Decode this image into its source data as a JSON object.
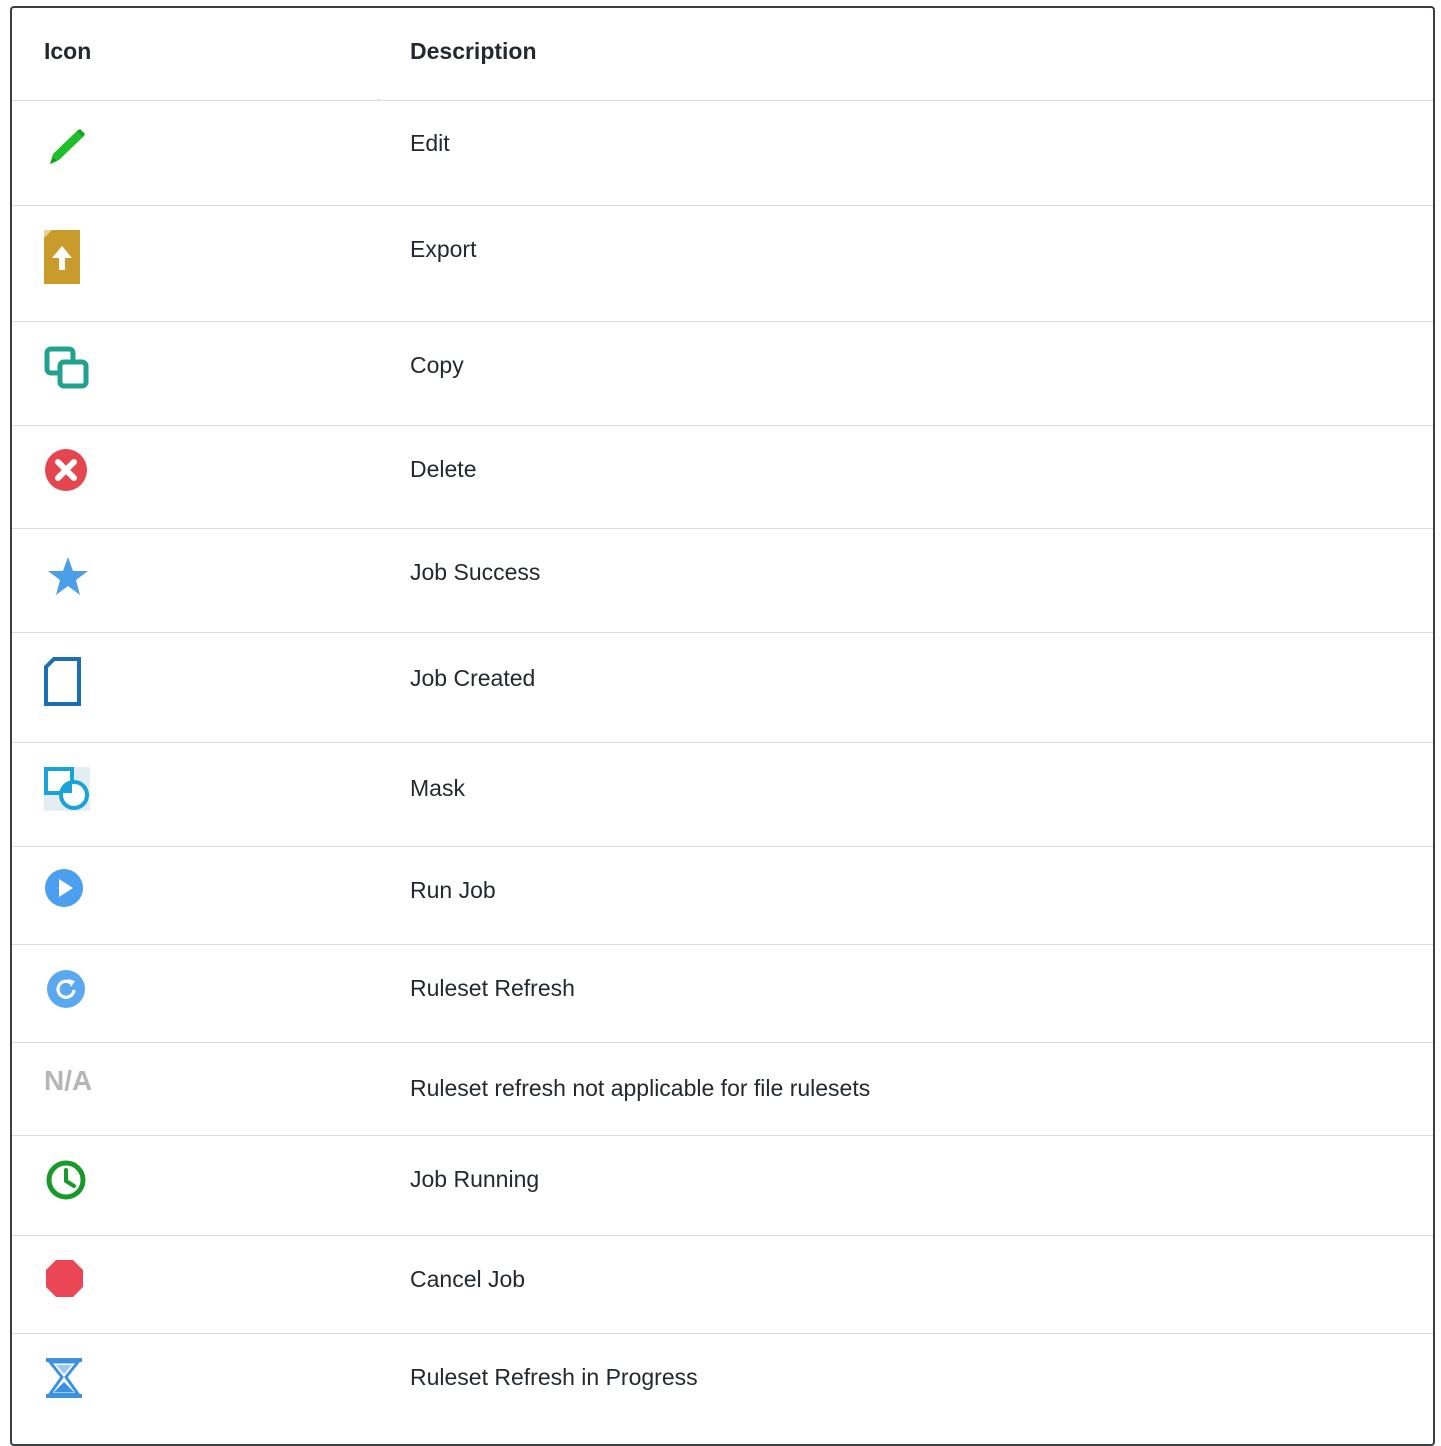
{
  "table": {
    "headers": {
      "icon": "Icon",
      "description": "Description"
    },
    "rows": [
      {
        "icon": "pencil-icon",
        "description": "Edit"
      },
      {
        "icon": "export-file-icon",
        "description": "Export"
      },
      {
        "icon": "copy-icon",
        "description": "Copy"
      },
      {
        "icon": "delete-x-circle-icon",
        "description": "Delete"
      },
      {
        "icon": "star-icon",
        "description": "Job Success"
      },
      {
        "icon": "document-icon",
        "description": "Job Created"
      },
      {
        "icon": "mask-icon",
        "description": "Mask"
      },
      {
        "icon": "play-circle-icon",
        "description": "Run Job"
      },
      {
        "icon": "refresh-circle-icon",
        "description": "Ruleset Refresh"
      },
      {
        "icon": "not-applicable-text",
        "icon_text": "N/A",
        "description": "Ruleset refresh not applicable for file rulesets"
      },
      {
        "icon": "clock-icon",
        "description": "Job Running"
      },
      {
        "icon": "stop-octagon-icon",
        "description": "Cancel Job"
      },
      {
        "icon": "hourglass-icon",
        "description": "Ruleset Refresh in Progress"
      }
    ]
  },
  "colors": {
    "edit": "#1fbf2a",
    "export": "#c99b2a",
    "copy": "#20a28e",
    "delete": "#e5454f",
    "star": "#4a9fe8",
    "document": "#1a6fb5",
    "mask": "#1aa3d8",
    "run": "#4b9ff0",
    "refresh": "#5aa8ef",
    "na_text": "#b6b6b6",
    "clock": "#179a2a",
    "cancel": "#ea4656",
    "hourglass": "#3d92e0",
    "border": "#3a3f44",
    "row_line": "#dcdcdc",
    "text": "#24292e"
  }
}
